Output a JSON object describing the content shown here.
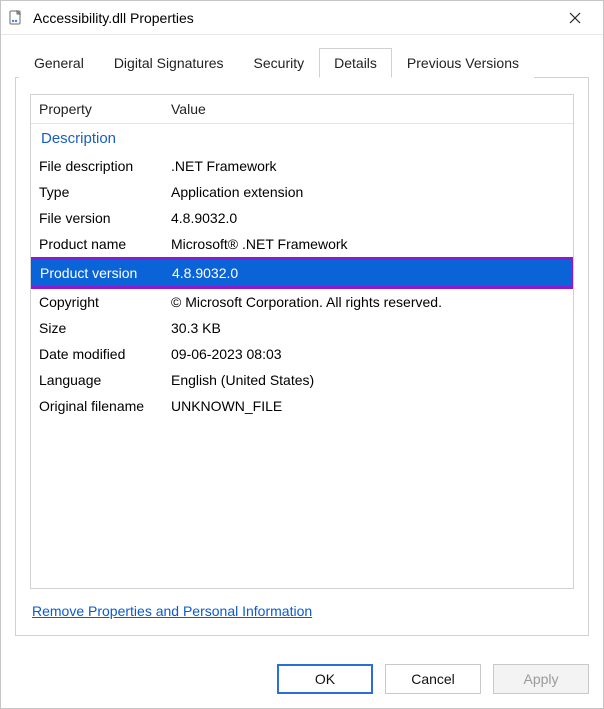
{
  "window": {
    "title": "Accessibility.dll Properties"
  },
  "tabs": {
    "items": [
      {
        "label": "General"
      },
      {
        "label": "Digital Signatures"
      },
      {
        "label": "Security"
      },
      {
        "label": "Details",
        "active": true
      },
      {
        "label": "Previous Versions"
      }
    ]
  },
  "details": {
    "columns": {
      "property": "Property",
      "value": "Value"
    },
    "section": "Description",
    "rows": [
      {
        "property": "File description",
        "value": ".NET Framework"
      },
      {
        "property": "Type",
        "value": "Application extension"
      },
      {
        "property": "File version",
        "value": "4.8.9032.0"
      },
      {
        "property": "Product name",
        "value": "Microsoft® .NET Framework"
      },
      {
        "property": "Product version",
        "value": "4.8.9032.0",
        "selected": true,
        "highlighted": true
      },
      {
        "property": "Copyright",
        "value": "© Microsoft Corporation.  All rights reserved."
      },
      {
        "property": "Size",
        "value": "30.3 KB"
      },
      {
        "property": "Date modified",
        "value": "09-06-2023 08:03"
      },
      {
        "property": "Language",
        "value": "English (United States)"
      },
      {
        "property": "Original filename",
        "value": "UNKNOWN_FILE"
      }
    ]
  },
  "link": {
    "remove": "Remove Properties and Personal Information"
  },
  "buttons": {
    "ok": "OK",
    "cancel": "Cancel",
    "apply": "Apply"
  }
}
